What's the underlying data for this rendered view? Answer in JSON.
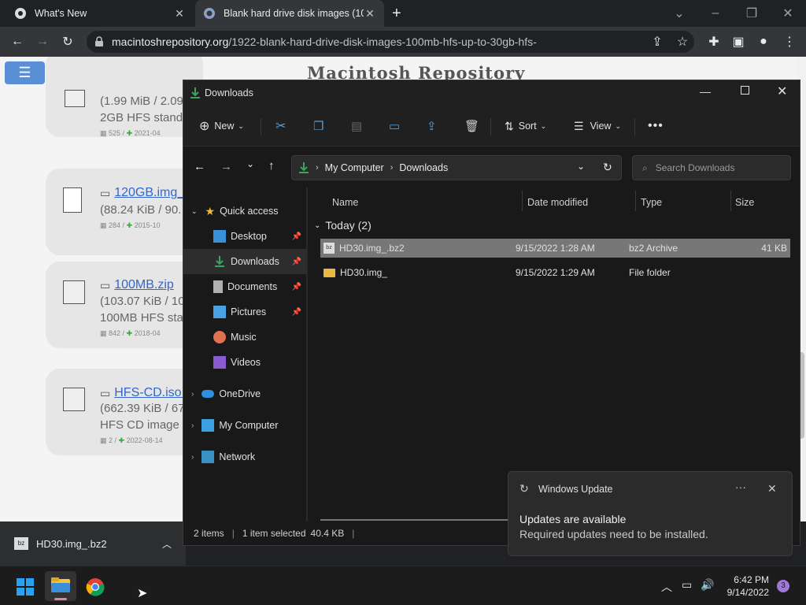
{
  "browser": {
    "tabs": [
      {
        "title": "What's New"
      },
      {
        "title": "Blank hard drive disk images (10"
      }
    ],
    "new_tab": "+",
    "url_host": "macintoshrepository.org",
    "url_path": "/1922-blank-hard-drive-disk-images-100mb-hfs-up-to-30gb-hfs-"
  },
  "page": {
    "site_title": "Macintosh Repository",
    "items": [
      {
        "name": "",
        "size": "(1.99 MiB / 2.09",
        "desc": "2GB HFS stand",
        "count": "525",
        "date": "2021-04"
      },
      {
        "name": "120GB.img_",
        "size": "(88.24 KiB / 90.",
        "desc": "",
        "count": "284",
        "date": "2015-10"
      },
      {
        "name": "100MB.zip",
        "size": "(103.07 KiB / 10",
        "desc": "100MB HFS sta",
        "count": "842",
        "date": "2018-04"
      },
      {
        "name": "HFS-CD.iso.",
        "size": "(662.39 KiB / 67",
        "desc": "HFS CD image",
        "count": "2",
        "date": "2022-08-14"
      }
    ]
  },
  "download_bar": {
    "file": "HD30.img_.bz2"
  },
  "explorer": {
    "title": "Downloads",
    "commands": {
      "new": "New",
      "sort": "Sort",
      "view": "View"
    },
    "breadcrumb": [
      "My Computer",
      "Downloads"
    ],
    "search_placeholder": "Search Downloads",
    "nav": {
      "quick_access": "Quick access",
      "desktop": "Desktop",
      "downloads": "Downloads",
      "documents": "Documents",
      "pictures": "Pictures",
      "music": "Music",
      "videos": "Videos",
      "onedrive": "OneDrive",
      "my_computer": "My Computer",
      "network": "Network"
    },
    "columns": {
      "name": "Name",
      "date": "Date modified",
      "type": "Type",
      "size": "Size"
    },
    "group": "Today (2)",
    "files": [
      {
        "name": "HD30.img_.bz2",
        "date": "9/15/2022 1:28 AM",
        "type": "bz2 Archive",
        "size": "41 KB"
      },
      {
        "name": "HD30.img_",
        "date": "9/15/2022 1:29 AM",
        "type": "File folder",
        "size": ""
      }
    ],
    "status": {
      "items": "2 items",
      "selected": "1 item selected",
      "size": "40.4 KB"
    }
  },
  "toast": {
    "app": "Windows Update",
    "title": "Updates are available",
    "body": "Required updates need to be installed."
  },
  "taskbar": {
    "time": "6:42 PM",
    "date": "9/14/2022",
    "badge": "3"
  }
}
